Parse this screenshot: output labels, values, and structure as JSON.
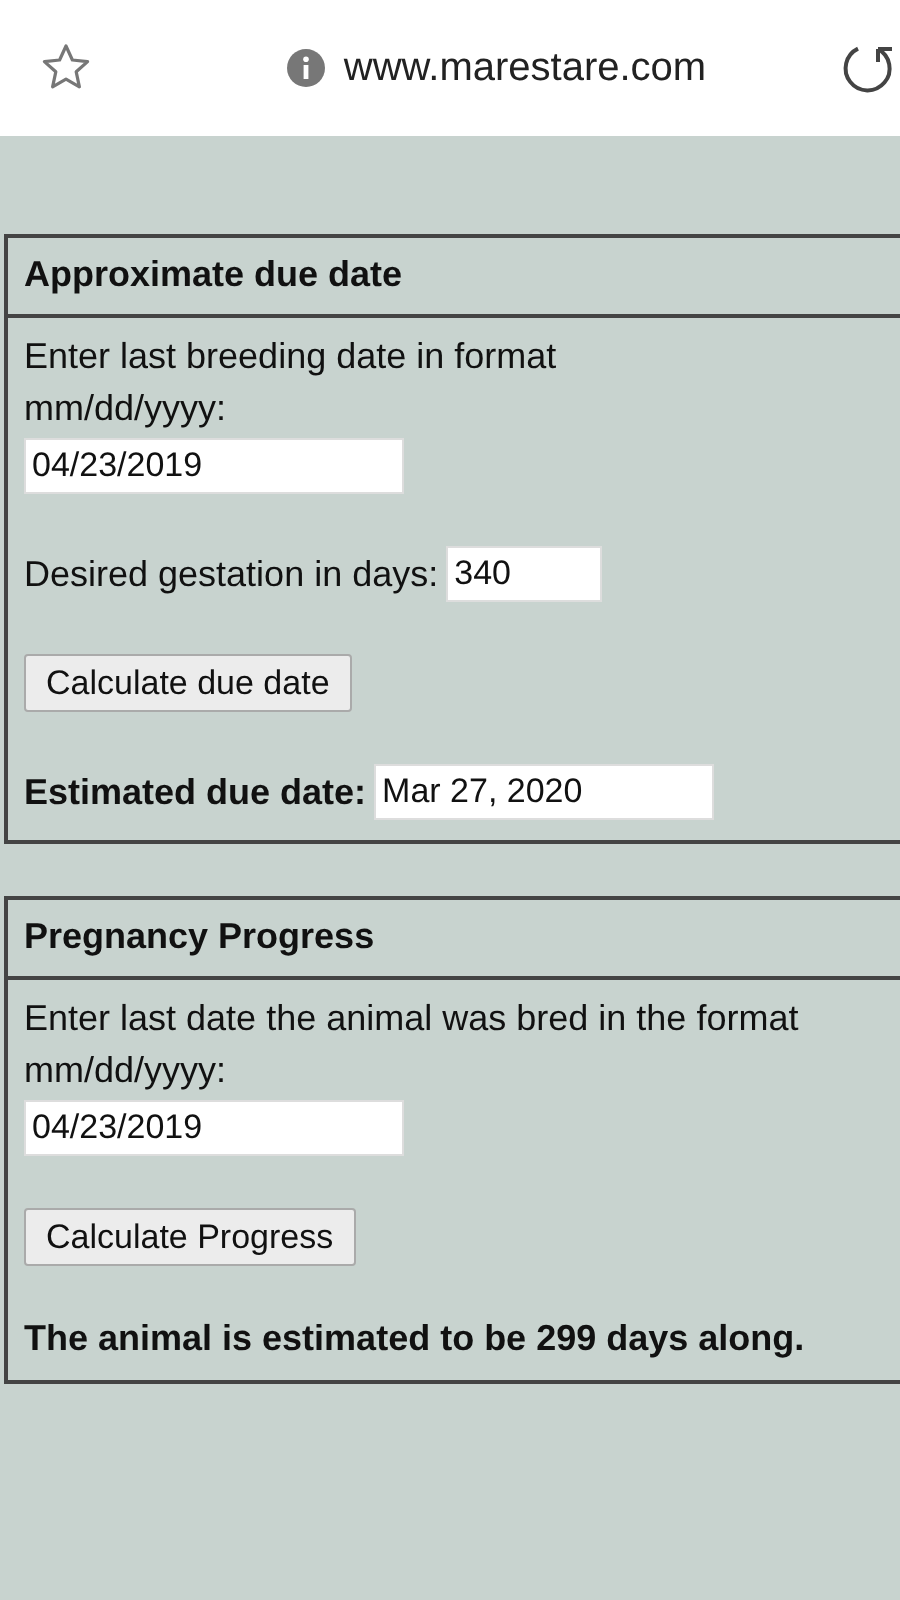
{
  "address_bar": {
    "url": "www.marestare.com"
  },
  "sections": [
    {
      "title": "Approximate due date",
      "items": [
        {
          "kind": "prompt",
          "lines": [
            "Enter last breeding date in format",
            "mm/dd/yyyy:"
          ],
          "value": "04/23/2019"
        },
        {
          "kind": "inline",
          "label": "Desired gestation in days:",
          "value": "340"
        },
        {
          "kind": "button",
          "label": "Calculate due date"
        },
        {
          "kind": "result",
          "label": "Estimated due date:",
          "value": "Mar 27, 2020"
        }
      ]
    },
    {
      "title": "Pregnancy Progress",
      "items": [
        {
          "kind": "prompt",
          "lines": [
            "Enter last date the animal was bred in the format",
            "mm/dd/yyyy:"
          ],
          "value": "04/23/2019"
        },
        {
          "kind": "button",
          "label": "Calculate Progress"
        },
        {
          "kind": "message",
          "text": "The animal is estimated to be 299 days along."
        }
      ]
    }
  ]
}
